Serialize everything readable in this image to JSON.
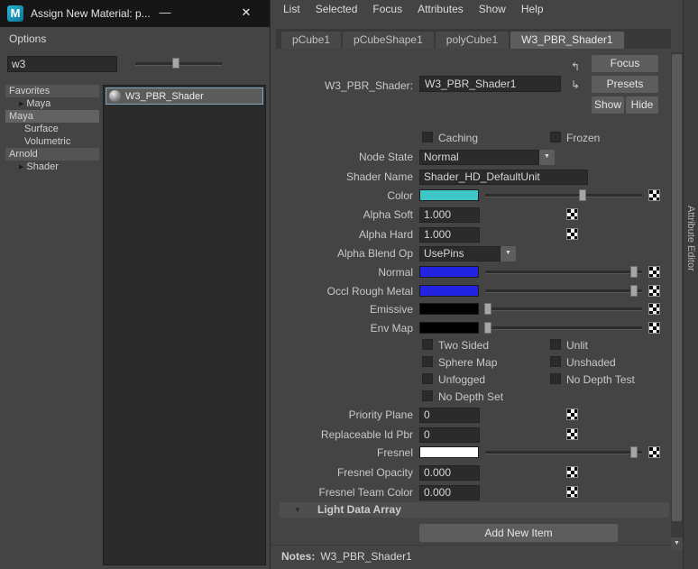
{
  "dialog": {
    "title": "Assign New Material: p...",
    "options_menu": "Options",
    "search_value": "w3",
    "tree": {
      "favorites": "Favorites",
      "maya_child": "Maya",
      "maya_header": "Maya",
      "surface": "Surface",
      "volumetric": "Volumetric",
      "arnold": "Arnold",
      "shader": "Shader"
    },
    "result_item": "W3_PBR_Shader"
  },
  "icons": {
    "maya_logo": "M",
    "minimize": "—",
    "close": "✕",
    "dropdown_arrow": "▼",
    "section_collapse": "▼",
    "tree_branch": "▶",
    "scroll_down": "▼",
    "conn_in": "↰",
    "conn_out": "↳"
  },
  "menubar": [
    "List",
    "Selected",
    "Focus",
    "Attributes",
    "Show",
    "Help"
  ],
  "tabs": [
    "pCube1",
    "pCubeShape1",
    "polyCube1",
    "W3_PBR_Shader1"
  ],
  "editor": {
    "node_type_label": "W3_PBR_Shader:",
    "node_name": "W3_PBR_Shader1",
    "focus": "Focus",
    "presets": "Presets",
    "show": "Show",
    "hide": "Hide",
    "caching": "Caching",
    "frozen": "Frozen",
    "node_state_label": "Node State",
    "node_state": "Normal",
    "shader_name_label": "Shader Name",
    "shader_name": "Shader_HD_DefaultUnit",
    "color_label": "Color",
    "alpha_soft_label": "Alpha Soft",
    "alpha_soft": "1.000",
    "alpha_hard_label": "Alpha Hard",
    "alpha_hard": "1.000",
    "alpha_blend_label": "Alpha Blend Op",
    "alpha_blend": "UsePins",
    "normal_label": "Normal",
    "occl_label": "Occl Rough Metal",
    "emissive_label": "Emissive",
    "env_map_label": "Env Map",
    "two_sided": "Two Sided",
    "unlit": "Unlit",
    "sphere_map": "Sphere Map",
    "unshaded": "Unshaded",
    "unfogged": "Unfogged",
    "no_depth_test": "No Depth Test",
    "no_depth_set": "No Depth Set",
    "priority_plane_label": "Priority Plane",
    "priority_plane": "0",
    "replaceable_label": "Replaceable Id Pbr",
    "replaceable": "0",
    "fresnel_label": "Fresnel",
    "fresnel_opacity_label": "Fresnel Opacity",
    "fresnel_opacity": "0.000",
    "fresnel_team_label": "Fresnel Team Color",
    "fresnel_team": "0.000",
    "light_data_header": "Light Data Array",
    "add_new_item": "Add New Item",
    "notes_label": "Notes:",
    "notes_value": "W3_PBR_Shader1",
    "vertical_tab": "Attribute Editor"
  },
  "colors": {
    "color": "#3fc6c6",
    "normal": "#2323e2",
    "occl_rough_metal": "#2323e2",
    "emissive": "#000000",
    "env_map": "#000000",
    "fresnel": "#ffffff"
  },
  "sliders": {
    "search": 47,
    "color": 62,
    "normal": 95,
    "occl_rough_metal": 95,
    "emissive": 2,
    "env_map": 2,
    "fresnel": 95
  }
}
